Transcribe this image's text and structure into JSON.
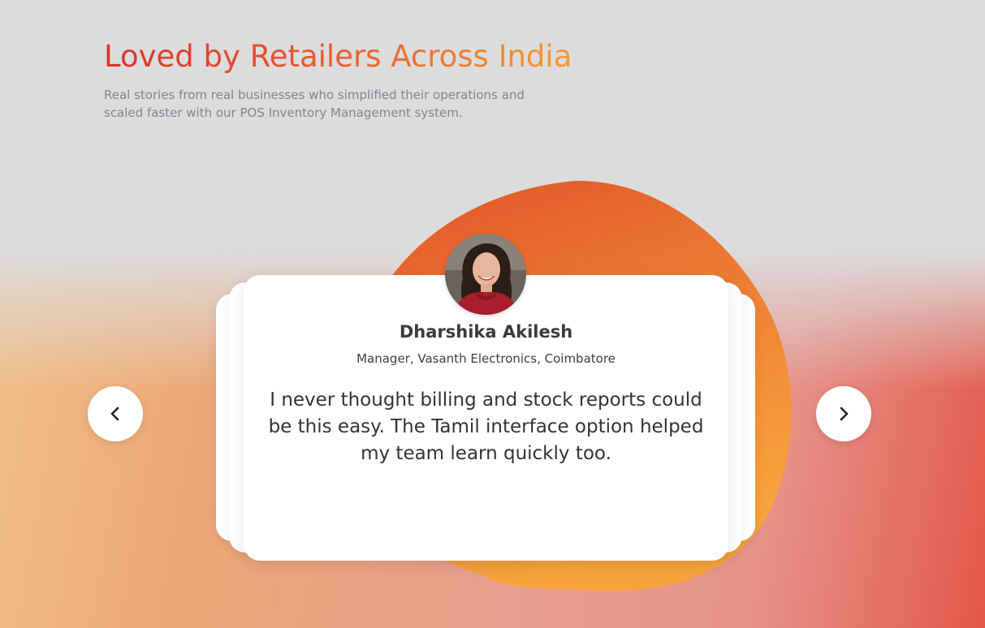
{
  "header": {
    "title": "Loved by Retailers Across India",
    "subtitle": "Real stories from real businesses who simplified their operations and scaled faster with our POS Inventory Management system."
  },
  "testimonial": {
    "name": "Dharshika Akilesh",
    "role": "Manager, Vasanth Electronics, Coimbatore",
    "quote": "I never thought billing and stock reports could be this easy. The Tamil interface option helped my team learn quickly too."
  },
  "navigation": {
    "prev_icon": "chevron-left-icon",
    "next_icon": "chevron-right-icon"
  },
  "colors": {
    "title_gradient_start": "#d9332c",
    "title_gradient_end": "#f0a035",
    "blob_top": "#e0532a",
    "blob_bottom": "#f8a43c",
    "subtitle": "#85828f"
  }
}
